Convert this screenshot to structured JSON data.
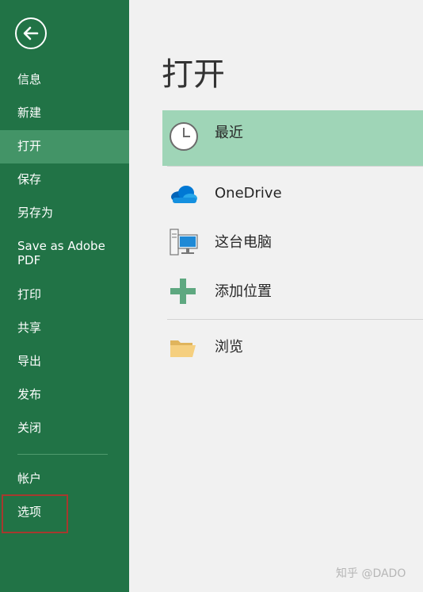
{
  "sidebar": {
    "items": [
      {
        "label": "信息"
      },
      {
        "label": "新建"
      },
      {
        "label": "打开"
      },
      {
        "label": "保存"
      },
      {
        "label": "另存为"
      },
      {
        "label": "Save as Adobe PDF"
      },
      {
        "label": "打印"
      },
      {
        "label": "共享"
      },
      {
        "label": "导出"
      },
      {
        "label": "发布"
      },
      {
        "label": "关闭"
      },
      {
        "label": "帐户"
      },
      {
        "label": "选项"
      }
    ],
    "active_item": "打开"
  },
  "main": {
    "title": "打开",
    "locations": [
      {
        "label": "最近",
        "icon": "clock-icon",
        "selected": true
      },
      {
        "label": "OneDrive",
        "icon": "cloud-icon"
      },
      {
        "label": "这台电脑",
        "icon": "computer-icon"
      },
      {
        "label": "添加位置",
        "icon": "plus-icon"
      },
      {
        "label": "浏览",
        "icon": "folder-icon"
      }
    ]
  },
  "watermark": "知乎 @DADO",
  "colors": {
    "sidebar_bg": "#217346",
    "sidebar_active": "#439467",
    "selected_item": "#9fd5b7",
    "highlight_box": "#a6392e",
    "main_bg": "#f1f1f1"
  }
}
